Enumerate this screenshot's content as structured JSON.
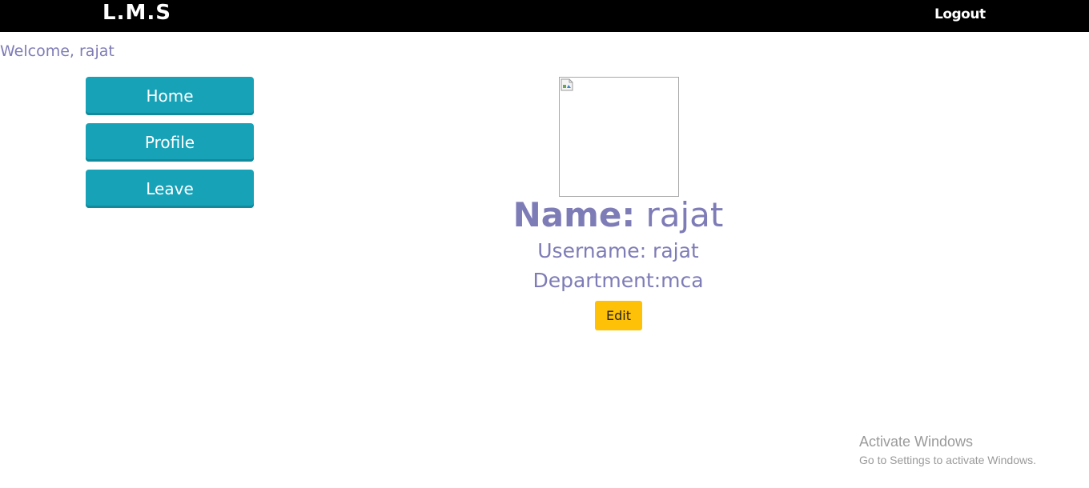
{
  "header": {
    "brand": "L.M.S",
    "logout_label": "Logout"
  },
  "welcome": {
    "text": "Welcome, rajat"
  },
  "sidebar": {
    "items": [
      {
        "label": "Home"
      },
      {
        "label": "Profile"
      },
      {
        "label": "Leave"
      }
    ]
  },
  "profile": {
    "name_label": "Name:",
    "name_value": "rajat",
    "username_text": "Username: rajat",
    "department_text": "Department:mca",
    "edit_label": "Edit",
    "photo_icon": "broken-image-icon"
  },
  "watermark": {
    "title": "Activate Windows",
    "subtitle": "Go to Settings to activate Windows."
  },
  "colors": {
    "header_bg": "#000000",
    "nav_button": "#17a2b8",
    "text_accent": "#7e7cb6",
    "edit_button": "#ffc107"
  }
}
